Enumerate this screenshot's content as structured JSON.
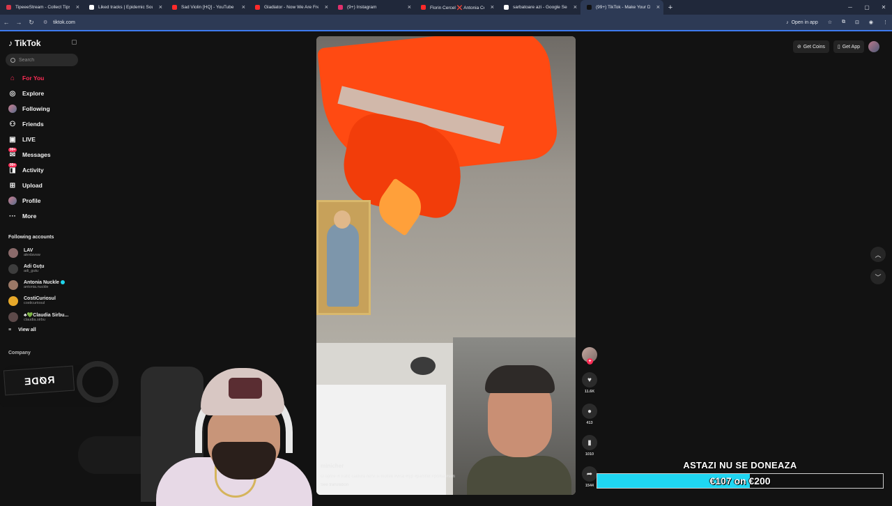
{
  "browser": {
    "tabs": [
      {
        "title": "TipeeeStream - Collect Tips wh",
        "color": "#d9384a",
        "active": false
      },
      {
        "title": "Liked tracks | Epidemic Sound",
        "color": "#ffffff",
        "active": false
      },
      {
        "title": "Sad Violin [HQ] - YouTube",
        "color": "#ff2a2a",
        "active": false
      },
      {
        "title": "Gladiator - Now We Are Free -",
        "color": "#ff2a2a",
        "active": false
      },
      {
        "title": "(9+) Instagram",
        "color": "#e1306c",
        "active": false
      },
      {
        "title": "Florin Cercel ❌ Antonia Cercel",
        "color": "#ff2a2a",
        "active": false
      },
      {
        "title": "sarbatoare azi - Google Search",
        "color": "#ffffff",
        "active": false
      },
      {
        "title": "(99+) TikTok - Make Your D",
        "color": "#111111",
        "active": true
      }
    ],
    "new_tab": "+",
    "url": "tiktok.com",
    "open_in_app": "Open in app"
  },
  "sidebar": {
    "logo": "TikTok",
    "search_placeholder": "Search",
    "nav": [
      {
        "label": "For You",
        "icon": "home-icon",
        "glyph": "⌂",
        "active": true
      },
      {
        "label": "Explore",
        "icon": "compass-icon",
        "glyph": "◎",
        "active": false
      },
      {
        "label": "Following",
        "icon": "following-avatar",
        "glyph": "",
        "active": false
      },
      {
        "label": "Friends",
        "icon": "friends-icon",
        "glyph": "⚇",
        "active": false
      },
      {
        "label": "LIVE",
        "icon": "live-icon",
        "glyph": "▣",
        "active": false
      },
      {
        "label": "Messages",
        "icon": "messages-icon",
        "glyph": "✉",
        "badge": "99+",
        "active": false
      },
      {
        "label": "Activity",
        "icon": "activity-icon",
        "glyph": "◨",
        "badge": "99+",
        "active": false
      },
      {
        "label": "Upload",
        "icon": "upload-icon",
        "glyph": "⊞",
        "active": false
      },
      {
        "label": "Profile",
        "icon": "profile-avatar",
        "glyph": "",
        "active": false
      },
      {
        "label": "More",
        "icon": "more-icon",
        "glyph": "···",
        "active": false
      }
    ],
    "following_title": "Following accounts",
    "accounts": [
      {
        "name": "LAV",
        "handle": "alexlavsw",
        "color": "#8a6a6a"
      },
      {
        "name": "Adi Guțu",
        "handle": "adi_gutu",
        "color": "#3d3d3d"
      },
      {
        "name": "Antonia Nuckle",
        "handle": "antonia.nuckle",
        "color": "#9b7866",
        "verified": true
      },
      {
        "name": "CostiCuriosul",
        "handle": "costicuriosul",
        "color": "#e6a82a"
      },
      {
        "name": "♣💚Claudia Sirbu...",
        "handle": "claudia.sirbu",
        "color": "#5d4a4a"
      }
    ],
    "view_all": "View all",
    "company": "Company"
  },
  "topbar": {
    "get_coins": "Get Coins",
    "get_app": "Get App"
  },
  "video": {
    "username": "minicher",
    "description": "O oprire in trafic caldura nervi si motive #viral #fyp #pamflet #politia #stiri",
    "translation": "See translation"
  },
  "actions": {
    "likes": "11.6K",
    "comments": "413",
    "saves": "1010",
    "shares": "1544"
  },
  "overlay": {
    "mic_brand": "RØDE",
    "donation_title": "ASTAZI NU SE DONEAZA",
    "donation_amount": "€107 on €200",
    "donation_progress": 0.535
  }
}
